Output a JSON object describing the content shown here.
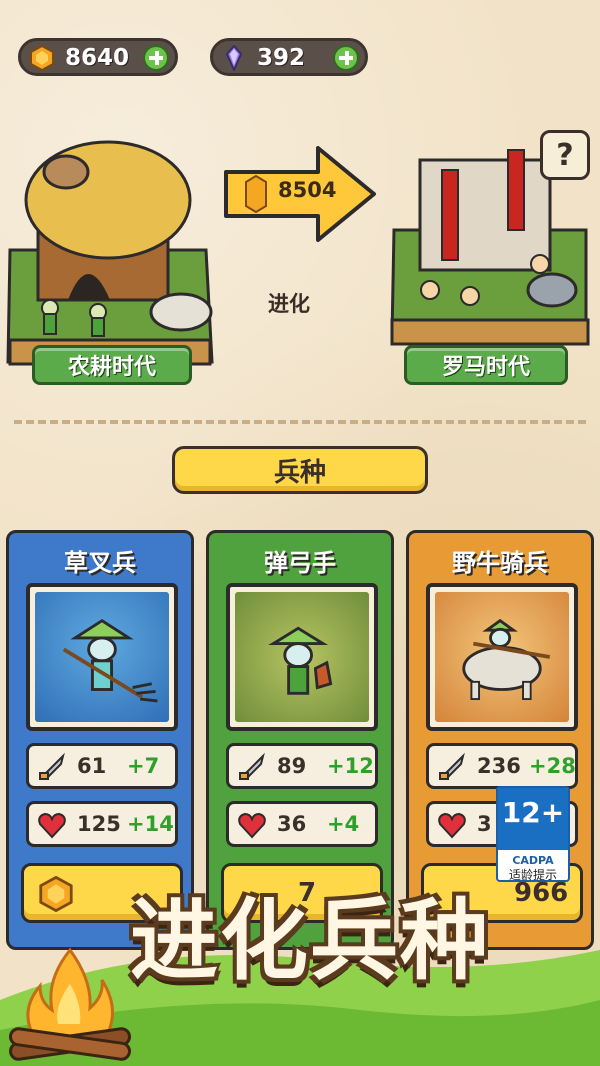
{
  "currencies": {
    "coins": "8640",
    "gems": "392"
  },
  "evolution": {
    "current_era": "农耕时代",
    "next_era": "罗马时代",
    "cost": "8504",
    "label": "进化",
    "help": "?"
  },
  "section_title": "兵种",
  "units": [
    {
      "name": "草叉兵",
      "attack": "61",
      "attack_bonus": "+7",
      "hp": "125",
      "hp_bonus": "+14",
      "price": ""
    },
    {
      "name": "弹弓手",
      "attack": "89",
      "attack_bonus": "+12",
      "hp": "36",
      "hp_bonus": "+4",
      "price": "7"
    },
    {
      "name": "野牛骑兵",
      "attack": "236",
      "attack_bonus": "+28",
      "hp": "3",
      "hp_bonus": "",
      "price": "966"
    }
  ],
  "age_rating": {
    "number": "12+",
    "org": "CADPA",
    "hint": "适龄提示"
  },
  "banner": "进化兵种",
  "colors": {
    "blue_card": "#3f79c9",
    "green_card": "#4fa23e",
    "orange_card": "#e89b34",
    "gold": "#ffd84a",
    "bonus_green": "#2ea12a"
  },
  "icons": [
    "coin-icon",
    "gem-icon",
    "plus-icon",
    "sword-icon",
    "heart-icon",
    "question-icon",
    "campfire-icon"
  ]
}
